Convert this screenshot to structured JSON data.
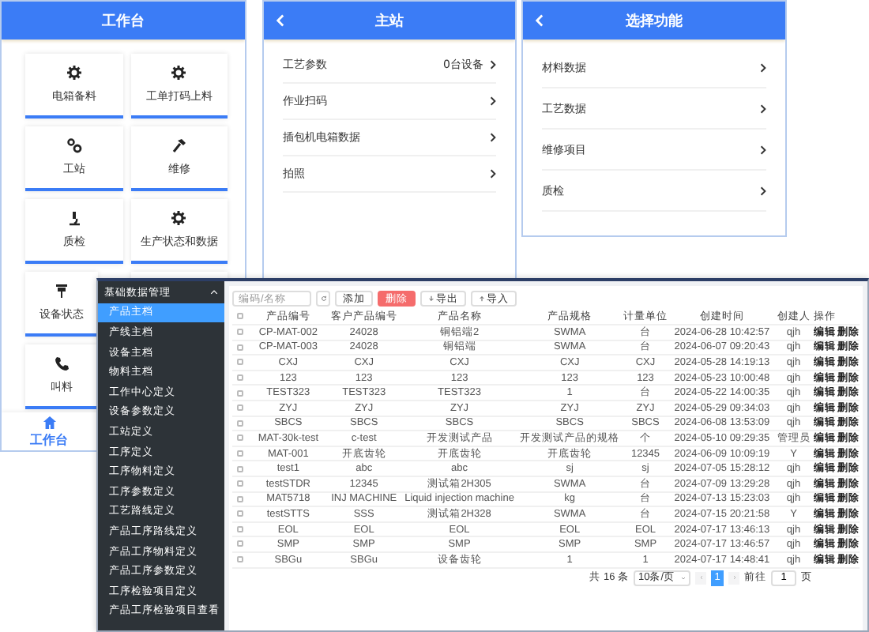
{
  "home_phone": {
    "title": "工作台",
    "tiles": [
      {
        "label": "电箱备料"
      },
      {
        "label": "工单打码上料"
      },
      {
        "label": "工站"
      },
      {
        "label": "维修"
      },
      {
        "label": "质检"
      },
      {
        "label": "生产状态和数据"
      },
      {
        "label": "设备状态"
      },
      {
        "covered": true
      },
      {
        "label": "叫料"
      }
    ],
    "nav": [
      {
        "label": "工作台",
        "selected": true
      }
    ]
  },
  "station_phone": {
    "title": "主站",
    "items": [
      {
        "label": "工艺参数",
        "value": "0台设备"
      },
      {
        "label": "作业扫码"
      },
      {
        "label": "插包机电箱数据"
      },
      {
        "label": "拍照"
      }
    ]
  },
  "function_phone": {
    "title": "选择功能",
    "items": [
      {
        "label": "材料数据"
      },
      {
        "label": "工艺数据"
      },
      {
        "label": "维修项目"
      },
      {
        "label": "质检"
      }
    ]
  },
  "admin": {
    "sidebar": {
      "group": {
        "label": "基础数据管理",
        "expanded": true
      },
      "items": [
        {
          "label": "产品主档",
          "selected": true
        },
        {
          "label": "产线主档",
          "selected": false
        },
        {
          "label": "设备主档",
          "selected": false
        },
        {
          "label": "物料主档",
          "selected": false
        },
        {
          "label": "工作中心定义",
          "selected": false
        },
        {
          "label": "设备参数定义",
          "selected": false
        },
        {
          "label": "工站定义",
          "selected": false
        },
        {
          "label": "工序定义",
          "selected": false
        },
        {
          "label": "工序物料定义",
          "selected": false
        },
        {
          "label": "工序参数定义",
          "selected": false
        },
        {
          "label": "工艺路线定义",
          "selected": false
        },
        {
          "label": "产品工序路线定义",
          "selected": false
        },
        {
          "label": "产品工序物料定义",
          "selected": false
        },
        {
          "label": "产品工序参数定义",
          "selected": false
        },
        {
          "label": "工序检验项目定义",
          "selected": false
        },
        {
          "label": "产品工序检验项目查看",
          "selected": false
        }
      ]
    },
    "toolbar": {
      "search": {
        "placeholder": "编码/名称"
      },
      "buttons": [
        {
          "label": "添加",
          "kind": "plain"
        },
        {
          "label": "删除",
          "kind": "danger"
        },
        {
          "label": "导出",
          "kind": "export"
        },
        {
          "label": "导入",
          "kind": "import"
        }
      ]
    },
    "table": {
      "all_checked": false,
      "columns": [
        "产品编号",
        "客户产品编号",
        "产品名称",
        "产品规格",
        "计量单位",
        "创建时间",
        "创建人",
        "操作"
      ],
      "rows": [
        {
          "checked": false,
          "cells": [
            "CP-MAT-002",
            "24028",
            "铜铝端2",
            "SWMA",
            "台",
            "2024-06-28 10:42:57",
            "qjh"
          ],
          "actions": [
            "编辑",
            "删除"
          ]
        },
        {
          "checked": false,
          "cells": [
            "CP-MAT-003",
            "24028",
            "铜铝端",
            "SWMA",
            "台",
            "2024-06-07 09:20:43",
            "qjh"
          ],
          "actions": [
            "编辑",
            "删除"
          ]
        },
        {
          "checked": false,
          "cells": [
            "CXJ",
            "CXJ",
            "CXJ",
            "CXJ",
            "CXJ",
            "2024-05-28 14:19:13",
            "qjh"
          ],
          "actions": [
            "编辑",
            "删除"
          ]
        },
        {
          "checked": false,
          "cells": [
            "123",
            "123",
            "123",
            "123",
            "123",
            "2024-05-23 10:00:48",
            "qjh"
          ],
          "actions": [
            "编辑",
            "删除"
          ]
        },
        {
          "checked": false,
          "cells": [
            "TEST323",
            "TEST323",
            "TEST323",
            "1",
            "台",
            "2024-05-22 14:00:35",
            "qjh"
          ],
          "actions": [
            "编辑",
            "删除"
          ]
        },
        {
          "checked": false,
          "cells": [
            "ZYJ",
            "ZYJ",
            "ZYJ",
            "ZYJ",
            "ZYJ",
            "2024-05-29 09:34:03",
            "qjh"
          ],
          "actions": [
            "编辑",
            "删除"
          ]
        },
        {
          "checked": false,
          "cells": [
            "SBCS",
            "SBCS",
            "SBCS",
            "SBCS",
            "SBCS",
            "2024-06-08 13:53:09",
            "qjh"
          ],
          "actions": [
            "编辑",
            "删除"
          ]
        },
        {
          "checked": false,
          "cells": [
            "MAT-30k-test",
            "c-test",
            "开发测试产品",
            "开发测试产品的规格",
            "个",
            "2024-05-10 09:29:35",
            "管理员"
          ],
          "actions": [
            "编辑",
            "删除"
          ]
        },
        {
          "checked": false,
          "cells": [
            "MAT-001",
            "开底齿轮",
            "开底齿轮",
            "开底齿轮",
            "12345",
            "2024-06-09 10:09:19",
            "Y"
          ],
          "actions": [
            "编辑",
            "删除"
          ]
        },
        {
          "checked": false,
          "cells": [
            "test1",
            "abc",
            "abc",
            "sj",
            "sj",
            "2024-07-05 15:28:12",
            "qjh"
          ],
          "actions": [
            "编辑",
            "删除"
          ]
        },
        {
          "checked": false,
          "cells": [
            "testSTDR",
            "12345",
            "测试箱2H305",
            "SWMA",
            "台",
            "2024-07-09 13:29:28",
            "qjh"
          ],
          "actions": [
            "编辑",
            "删除"
          ]
        },
        {
          "checked": false,
          "cells": [
            "MAT5718",
            "INJ MACHINE",
            "Liquid injection machine",
            "kg",
            "台",
            "2024-07-13 15:23:03",
            "qjh"
          ],
          "actions": [
            "编辑",
            "删除"
          ]
        },
        {
          "checked": false,
          "cells": [
            "testSTTS",
            "SSS",
            "测试箱2H328",
            "SWMA",
            "台",
            "2024-07-15 20:21:58",
            "Y"
          ],
          "actions": [
            "编辑",
            "删除"
          ]
        },
        {
          "checked": false,
          "cells": [
            "EOL",
            "EOL",
            "EOL",
            "EOL",
            "EOL",
            "2024-07-17 13:46:13",
            "qjh"
          ],
          "actions": [
            "编辑",
            "删除"
          ]
        },
        {
          "checked": false,
          "cells": [
            "SMP",
            "SMP",
            "SMP",
            "SMP",
            "SMP",
            "2024-07-17 13:46:57",
            "qjh"
          ],
          "actions": [
            "编辑",
            "删除"
          ]
        },
        {
          "checked": false,
          "cells": [
            "SBGu",
            "SBGu",
            "设备齿轮",
            "1",
            "1",
            "2024-07-17 14:48:41",
            "qjh"
          ],
          "actions": [
            "编辑",
            "删除"
          ]
        }
      ]
    },
    "pagination": {
      "total": "共 16 条",
      "page_size": "10条/页",
      "pages": [
        {
          "label": "1",
          "selected": true
        }
      ],
      "goto_label": "前往",
      "goto_value": "1",
      "goto_suffix": "页"
    }
  }
}
